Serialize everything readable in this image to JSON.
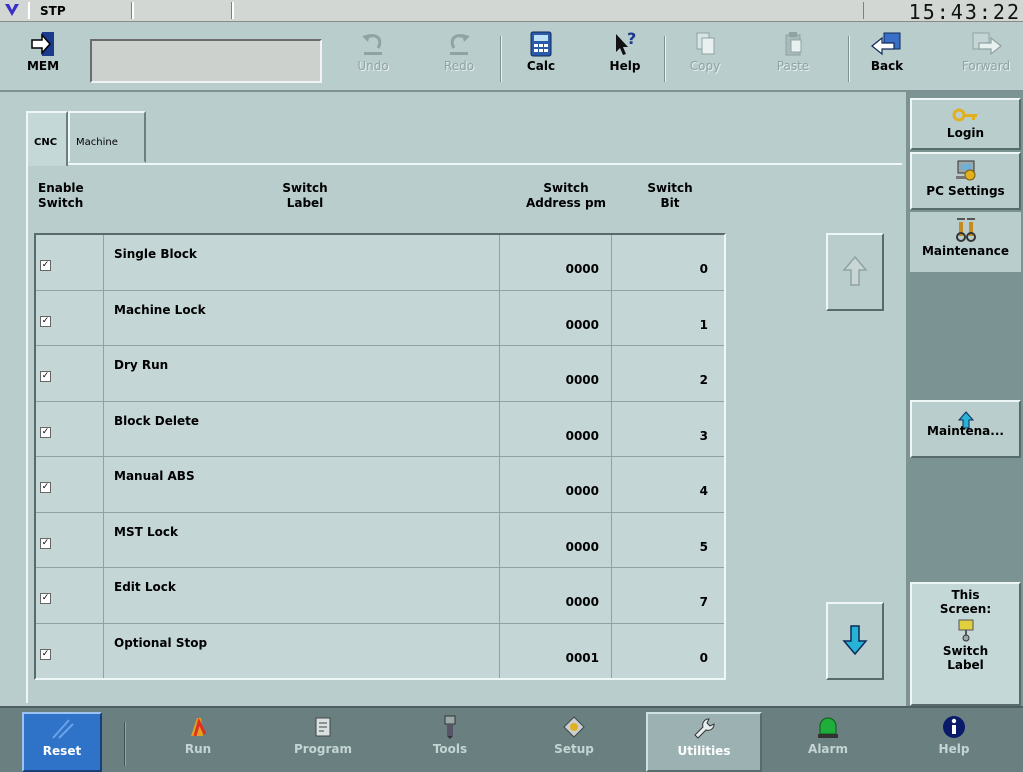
{
  "status": {
    "mode": "STP",
    "clock": "15:43:22"
  },
  "toolbar": {
    "mem_label": "MEM",
    "undo_label": "Undo",
    "redo_label": "Redo",
    "calc_label": "Calc",
    "help_label": "Help",
    "copy_label": "Copy",
    "paste_label": "Paste",
    "back_label": "Back",
    "forward_label": "Forward"
  },
  "tabs": [
    {
      "label": "CNC",
      "active": true
    },
    {
      "label": "Machine",
      "active": false
    }
  ],
  "table": {
    "headers": {
      "enable_line1": "Enable",
      "enable_line2": "Switch",
      "label_line1": "Switch",
      "label_line2": "Label",
      "address_line1": "Switch",
      "address_line2": "Address pm",
      "bit_line1": "Switch",
      "bit_line2": "Bit"
    },
    "rows": [
      {
        "enabled": true,
        "label": "Single Block",
        "address": "0000",
        "bit": "0"
      },
      {
        "enabled": true,
        "label": "Machine Lock",
        "address": "0000",
        "bit": "1"
      },
      {
        "enabled": true,
        "label": "Dry Run",
        "address": "0000",
        "bit": "2"
      },
      {
        "enabled": true,
        "label": "Block Delete",
        "address": "0000",
        "bit": "3"
      },
      {
        "enabled": true,
        "label": "Manual ABS",
        "address": "0000",
        "bit": "4"
      },
      {
        "enabled": true,
        "label": "MST Lock",
        "address": "0000",
        "bit": "5"
      },
      {
        "enabled": true,
        "label": "Edit Lock",
        "address": "0000",
        "bit": "7"
      },
      {
        "enabled": true,
        "label": "Optional Stop",
        "address": "0001",
        "bit": "0"
      }
    ]
  },
  "sidebar": {
    "login": "Login",
    "pc_settings": "PC Settings",
    "maintenance": "Maintenance",
    "maintena_button": "Maintena...",
    "this_screen_line1": "This",
    "this_screen_line2": "Screen:",
    "this_screen_line3": "Switch",
    "this_screen_line4": "Label"
  },
  "nav": {
    "reset": "Reset",
    "run": "Run",
    "program": "Program",
    "tools": "Tools",
    "setup": "Setup",
    "utilities": "Utilities",
    "alarm": "Alarm",
    "help": "Help"
  },
  "colors": {
    "background": "#b9cdcd",
    "reset_blue": "#2f73c8",
    "arrow_cyan": "#27b3d6",
    "alarm_green": "#1fae3a"
  }
}
